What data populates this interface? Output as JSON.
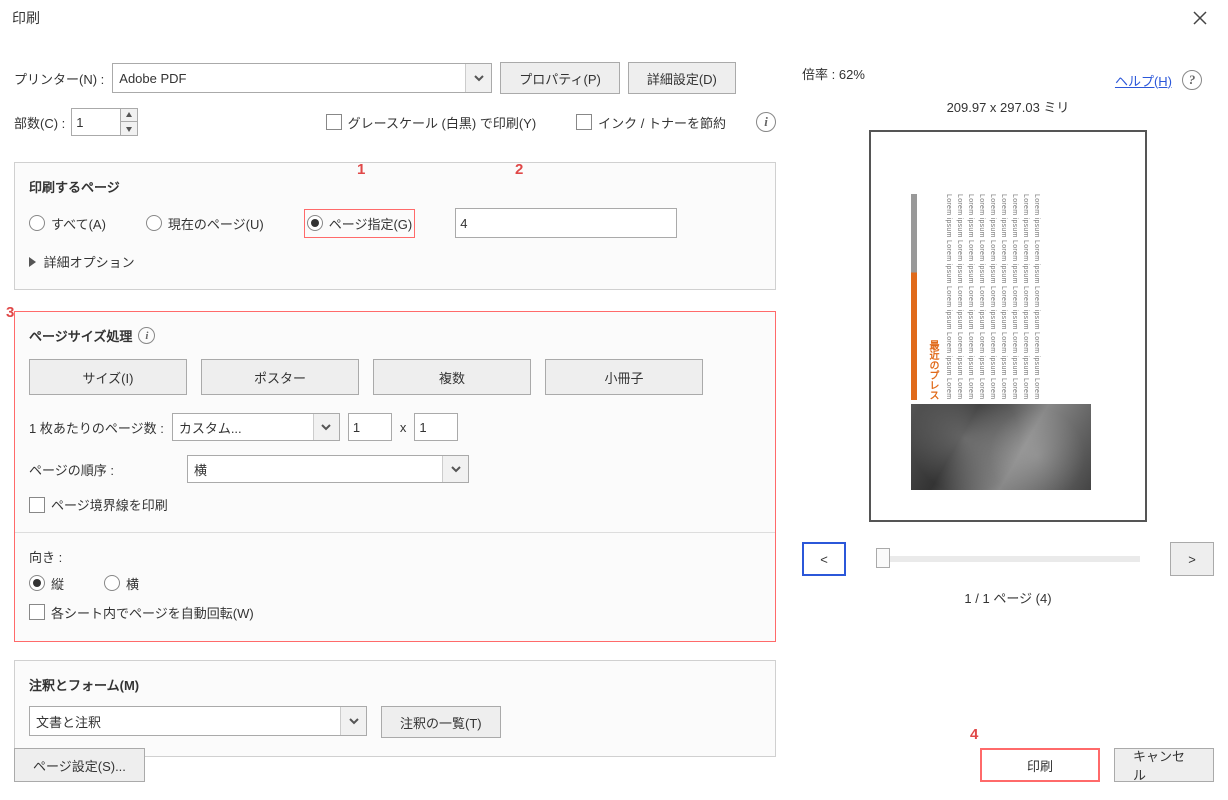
{
  "title": "印刷",
  "printer": {
    "label": "プリンター(N) :",
    "value": "Adobe PDF"
  },
  "buttons": {
    "properties": "プロパティ(P)",
    "advanced": "詳細設定(D)"
  },
  "help": "ヘルプ(H)",
  "copies": {
    "label": "部数(C) :",
    "value": "1"
  },
  "grayscale": "グレースケール (白黒) で印刷(Y)",
  "save_ink": "インク / トナーを節約",
  "pages_to_print": {
    "heading": "印刷するページ",
    "all": "すべて(A)",
    "current": "現在のページ(U)",
    "pages": "ページ指定(G)",
    "pages_value": "4",
    "more": "詳細オプション"
  },
  "annotations": {
    "n1": "1",
    "n2": "2",
    "n3": "3",
    "n4": "4"
  },
  "size_handling": {
    "heading": "ページサイズ処理",
    "size": "サイズ(I)",
    "poster": "ポスター",
    "multiple": "複数",
    "booklet": "小冊子",
    "per_sheet_label": "1 枚あたりのページ数 :",
    "per_sheet_value": "カスタム...",
    "cols": "1",
    "x": "x",
    "rows": "1",
    "order_label": "ページの順序 :",
    "order_value": "横",
    "border": "ページ境界線を印刷"
  },
  "orientation": {
    "label": "向き :",
    "portrait": "縦",
    "landscape": "横",
    "auto": "各シート内でページを自動回転(W)"
  },
  "comments": {
    "heading": "注釈とフォーム(M)",
    "value": "文書と注釈",
    "summary": "注釈の一覧(T)"
  },
  "page_setup": "ページ設定(S)...",
  "print": "印刷",
  "cancel": "キャンセル",
  "preview": {
    "scale_label": "倍率 :",
    "scale_value": "62%",
    "dims": "209.97 x 297.03 ミリ",
    "pager": "1 / 1 ページ (4)",
    "prev": "<",
    "next": ">",
    "orange": "最近のプレス"
  }
}
